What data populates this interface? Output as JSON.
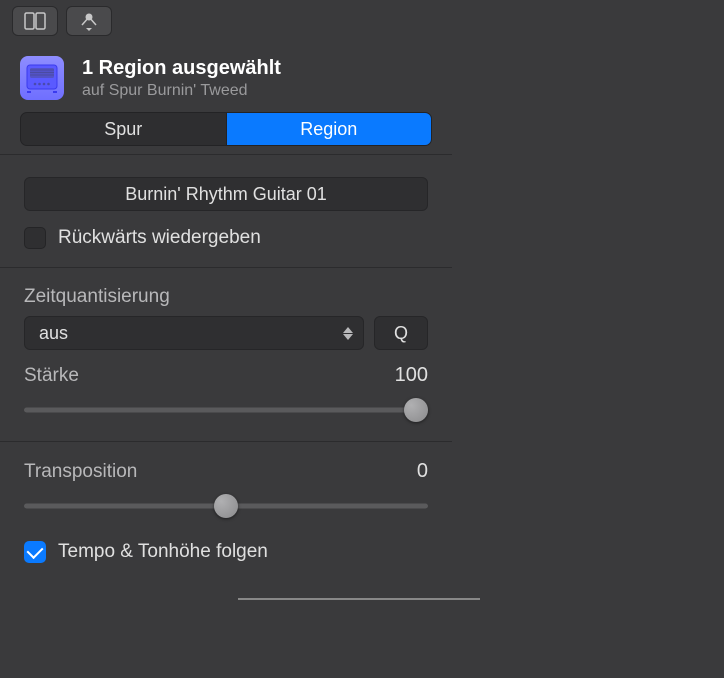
{
  "header": {
    "title": "1 Region ausgewählt",
    "subtitle": "auf Spur Burnin' Tweed"
  },
  "segments": {
    "track": "Spur",
    "region": "Region",
    "active": "region"
  },
  "region": {
    "name": "Burnin' Rhythm Guitar 01",
    "reverse_label": "Rückwärts wiedergeben",
    "reverse_checked": false
  },
  "quantize": {
    "label": "Zeitquantisierung",
    "value": "aus",
    "button": "Q",
    "strength_label": "Stärke",
    "strength_value": 100
  },
  "transpose": {
    "label": "Transposition",
    "value": 0,
    "follow_label": "Tempo & Tonhöhe folgen",
    "follow_checked": true
  }
}
